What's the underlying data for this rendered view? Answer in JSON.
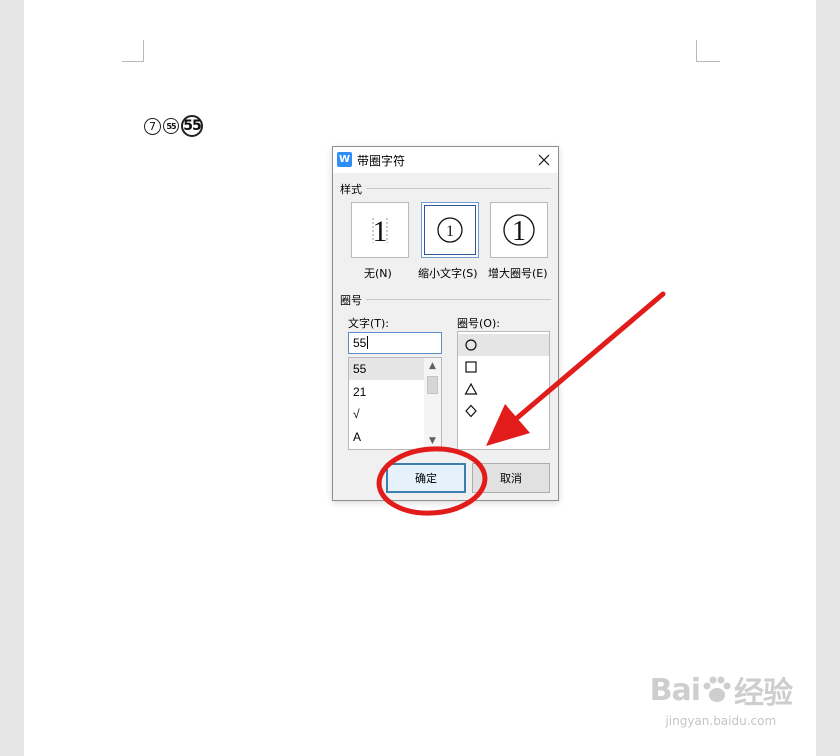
{
  "document": {
    "circled_chars": [
      "⑦",
      "55",
      "55"
    ]
  },
  "dialog": {
    "title": "带圈字符",
    "app_icon_letter": "W",
    "style_group": {
      "label": "样式",
      "options": [
        {
          "label": "无(N)",
          "glyph": "1"
        },
        {
          "label": "缩小文字(S)",
          "glyph": "1",
          "selected": true
        },
        {
          "label": "增大圈号(E)",
          "glyph": "1"
        }
      ]
    },
    "enclosure_group": {
      "label": "圈号",
      "text_label": "文字(T):",
      "text_value": "55",
      "text_options": [
        "55",
        "21",
        "√",
        "A"
      ],
      "shape_label": "圈号(O):",
      "shape_options": [
        "circle",
        "square",
        "triangle",
        "diamond"
      ]
    },
    "ok_label": "确定",
    "cancel_label": "取消"
  },
  "annotation": {
    "color": "#e21b1b"
  },
  "watermark": {
    "brand_left": "Bai",
    "brand_right": "经验",
    "url": "jingyan.baidu.com"
  }
}
